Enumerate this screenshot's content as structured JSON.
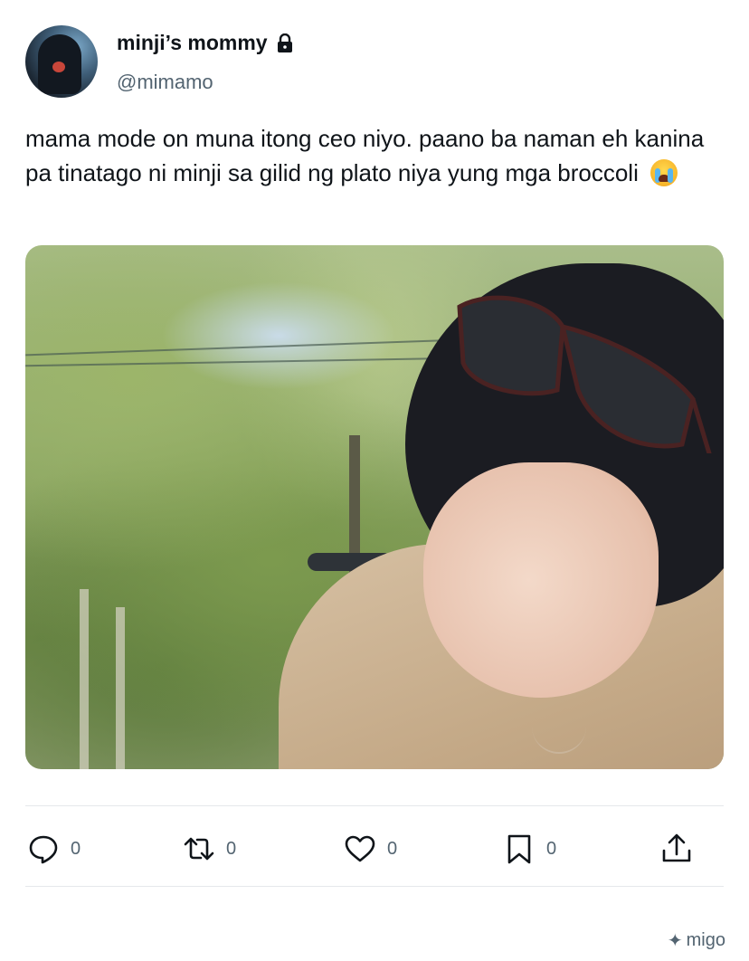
{
  "user": {
    "display_name": "minji’s mommy",
    "handle": "@mimamo"
  },
  "tweet": {
    "text": "mama mode on muna itong ceo niyo. paano ba naman eh kanina pa tinatago ni minji sa gilid ng plato niya yung mga broccoli",
    "emoji": "loudly-crying-face"
  },
  "actions": {
    "reply_count": "0",
    "retweet_count": "0",
    "like_count": "0",
    "bookmark_count": "0"
  },
  "footer": {
    "watermark": "migo"
  },
  "colors": {
    "text": "#0f1419",
    "secondary": "#536471",
    "divider": "#e5e8eb"
  }
}
